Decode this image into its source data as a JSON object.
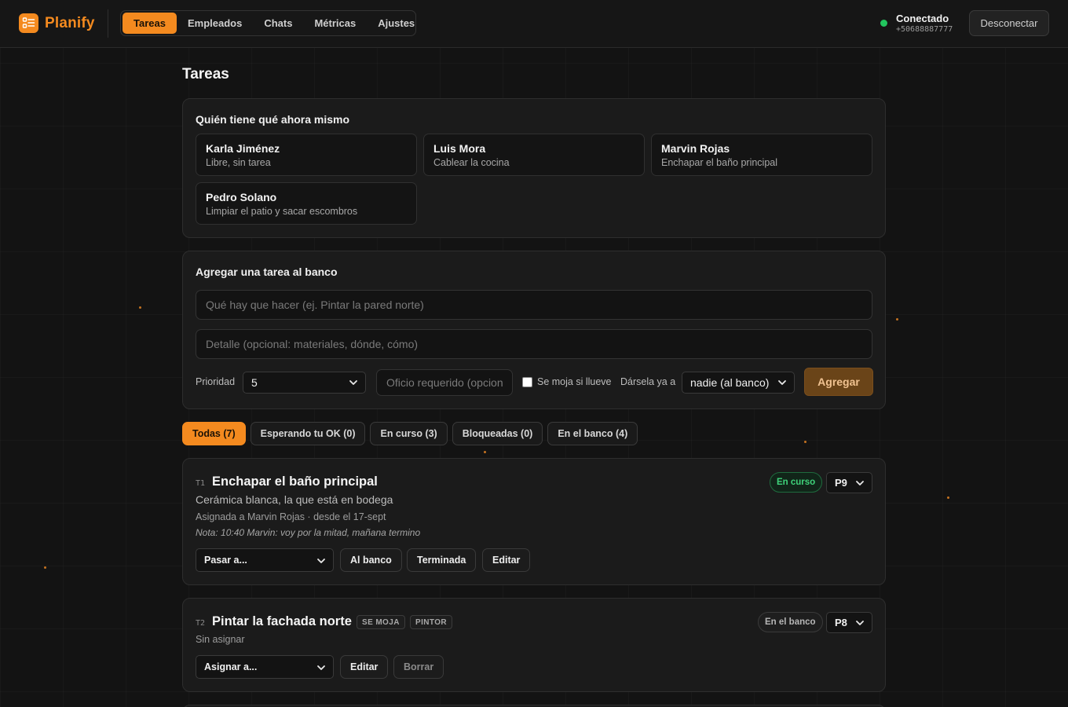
{
  "app": {
    "name": "Planify",
    "accent": "#f48a1f"
  },
  "nav": {
    "tabs": [
      {
        "label": "Tareas",
        "active": true
      },
      {
        "label": "Empleados"
      },
      {
        "label": "Chats"
      },
      {
        "label": "Métricas"
      },
      {
        "label": "Ajustes"
      }
    ]
  },
  "connection": {
    "status": "Conectado",
    "phone": "+50688887777",
    "disconnect_label": "Desconectar"
  },
  "page": {
    "title": "Tareas"
  },
  "who_has": {
    "title": "Quién tiene qué ahora mismo",
    "people": [
      {
        "name": "Karla Jiménez",
        "task": "Libre, sin tarea"
      },
      {
        "name": "Luis Mora",
        "task": "Cablear la cocina"
      },
      {
        "name": "Marvin Rojas",
        "task": "Enchapar el baño principal"
      },
      {
        "name": "Pedro Solano",
        "task": "Limpiar el patio y sacar escombros"
      }
    ]
  },
  "add_task": {
    "title": "Agregar una tarea al banco",
    "what_placeholder": "Qué hay que hacer (ej. Pintar la pared norte)",
    "detail_placeholder": "Detalle (opcional: materiales, dónde, cómo)",
    "priority_label": "Prioridad",
    "priority_value": "5",
    "trade_placeholder": "Oficio requerido (opcional)",
    "rain_label": "Se moja si llueve",
    "assign_label": "Dársela ya a",
    "assign_value": "nadie (al banco)",
    "add_label": "Agregar"
  },
  "filters": [
    {
      "label": "Todas (7)",
      "active": true
    },
    {
      "label": "Esperando tu OK (0)"
    },
    {
      "label": "En curso (3)"
    },
    {
      "label": "Bloqueadas (0)"
    },
    {
      "label": "En el banco (4)"
    }
  ],
  "tasks": [
    {
      "id": "T1",
      "title": "Enchapar el baño principal",
      "description": "Cerámica blanca, la que está en bodega",
      "meta": "Asignada a Marvin Rojas · desde el 17-sept",
      "note": "Nota: 10:40 Marvin: voy por la mitad, mañana termino",
      "status": "En curso",
      "priority": "P9",
      "move_select": "Pasar a...",
      "actions": [
        "Al banco",
        "Terminada",
        "Editar"
      ]
    },
    {
      "id": "T2",
      "title": "Pintar la fachada norte",
      "tags": [
        "SE MOJA",
        "PINTOR"
      ],
      "meta": "Sin asignar",
      "status": "En el banco",
      "priority": "P8",
      "assign_select": "Asignar a...",
      "actions": [
        "Editar",
        "Borrar"
      ]
    }
  ]
}
